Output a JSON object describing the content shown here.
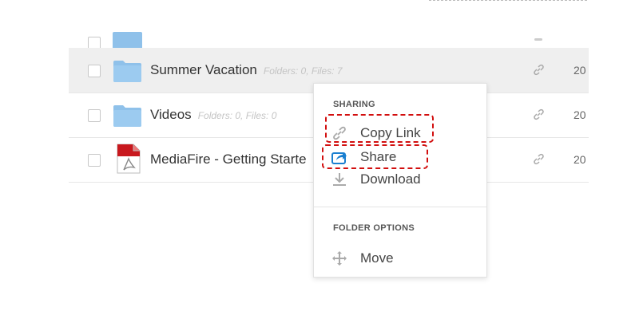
{
  "rows": [
    {
      "name": "Summer Vacation",
      "meta": "Folders: 0, Files: 7",
      "date": "20"
    },
    {
      "name": "Videos",
      "meta": "Folders: 0, Files: 0",
      "date": "20"
    },
    {
      "name": "MediaFire - Getting Starte",
      "meta": "",
      "date": "20"
    }
  ],
  "context_menu": {
    "sharing_header": "SHARING",
    "copy_link": "Copy Link",
    "share": "Share",
    "download": "Download",
    "folder_options_header": "FOLDER OPTIONS",
    "move": "Move"
  },
  "colors": {
    "folder": "#8fc1ea",
    "highlight_row": "#efefef",
    "callout": "#d20f0f",
    "share_icon": "#1a7fd0",
    "pdf_icon": "#c8181e"
  }
}
